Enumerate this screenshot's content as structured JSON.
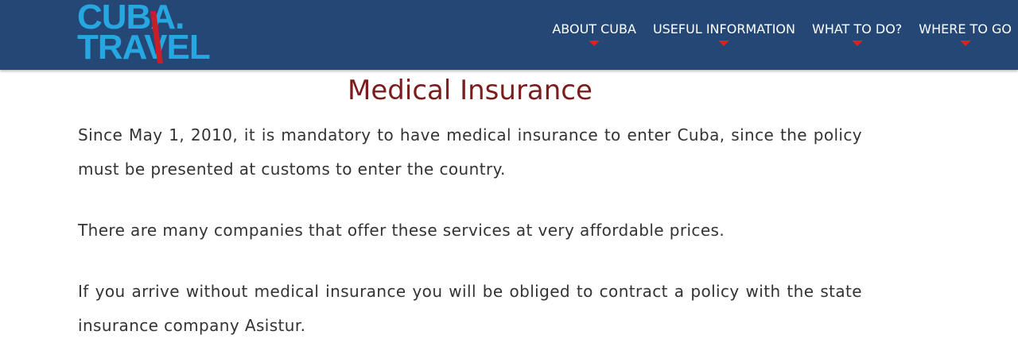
{
  "header": {
    "logo": {
      "line1": "CUBA.",
      "line2": "TRAVEL"
    },
    "nav": [
      {
        "label": "ABOUT CUBA"
      },
      {
        "label": "USEFUL INFORMATION"
      },
      {
        "label": "WHAT TO DO?"
      },
      {
        "label": "WHERE TO GO"
      }
    ]
  },
  "main": {
    "title": "Medical Insurance",
    "paragraphs": [
      "Since May 1, 2010, it is mandatory to have medical insurance to enter Cuba, since the policy must be presented at customs to enter the country.",
      "There are many companies that offer these services at very affordable prices.",
      "If you arrive without medical insurance you will be obliged to contract a policy with the state insurance company Asistur."
    ]
  },
  "colors": {
    "header_bg": "#244775",
    "logo_blue": "#27a7e1",
    "accent_red": "#e02020",
    "title_color": "#7b1d1d",
    "text_color": "#333333"
  }
}
